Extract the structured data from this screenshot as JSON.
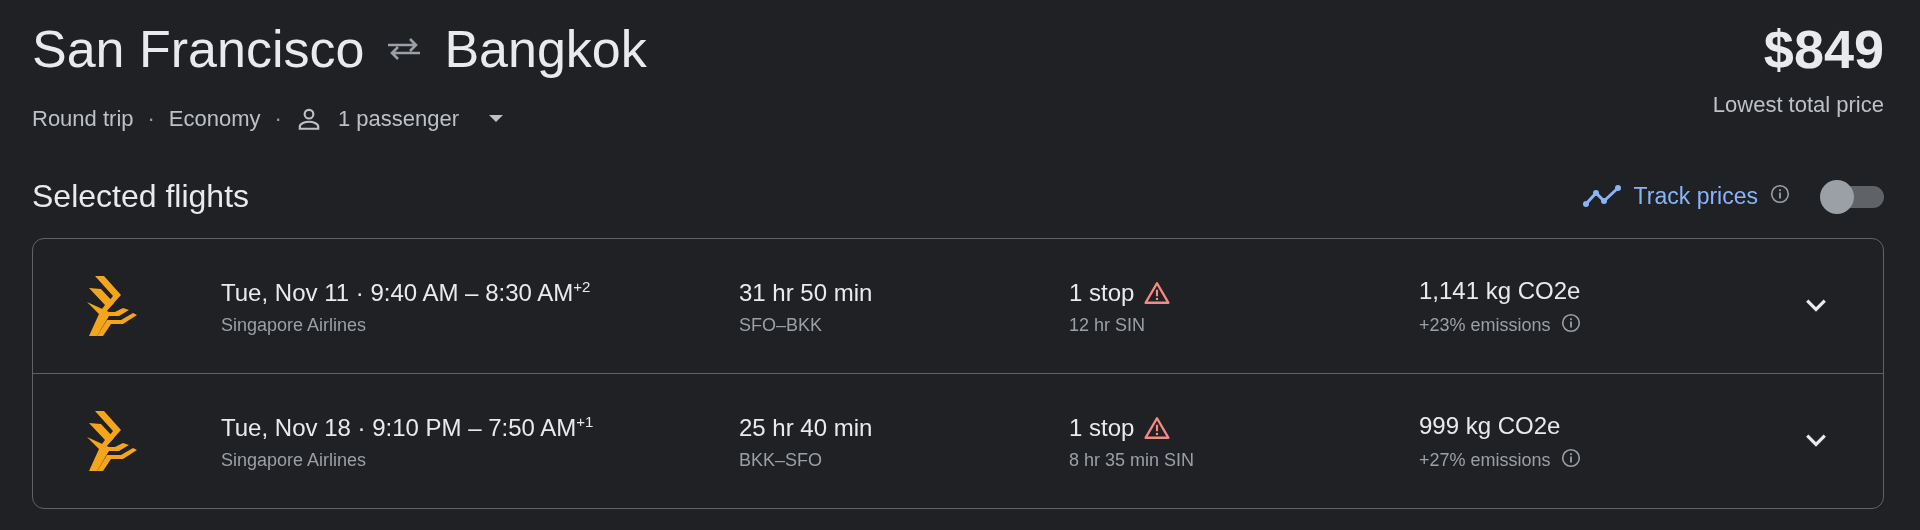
{
  "trip": {
    "origin": "San Francisco",
    "destination": "Bangkok",
    "price": "$849",
    "price_caption": "Lowest total price",
    "trip_type": "Round trip",
    "separator": "·",
    "cabin": "Economy",
    "passengers": "1 passenger"
  },
  "section": {
    "title": "Selected flights",
    "track_label": "Track prices",
    "track_on": false
  },
  "flights": [
    {
      "when": "Tue, Nov 11  ·  9:40 AM – 8:30 AM$^{+2}$",
      "airline": "Singapore Airlines",
      "duration": "31 hr 50 min",
      "route": "SFO–BKK",
      "stops": "1 stop",
      "layover": "12 hr SIN",
      "emissions": "1,141 kg CO2e",
      "emissions_delta": "+23% emissions",
      "expanded": false
    },
    {
      "when": "Tue, Nov 18  ·  9:10 PM – 7:50 AM$^{+1}$",
      "airline": "Singapore Airlines",
      "duration": "25 hr 40 min",
      "route": "BKK–SFO",
      "stops": "1 stop",
      "layover": "8 hr 35 min SIN",
      "emissions": "999 kg CO2e",
      "emissions_delta": "+27% emissions",
      "expanded": false
    }
  ]
}
